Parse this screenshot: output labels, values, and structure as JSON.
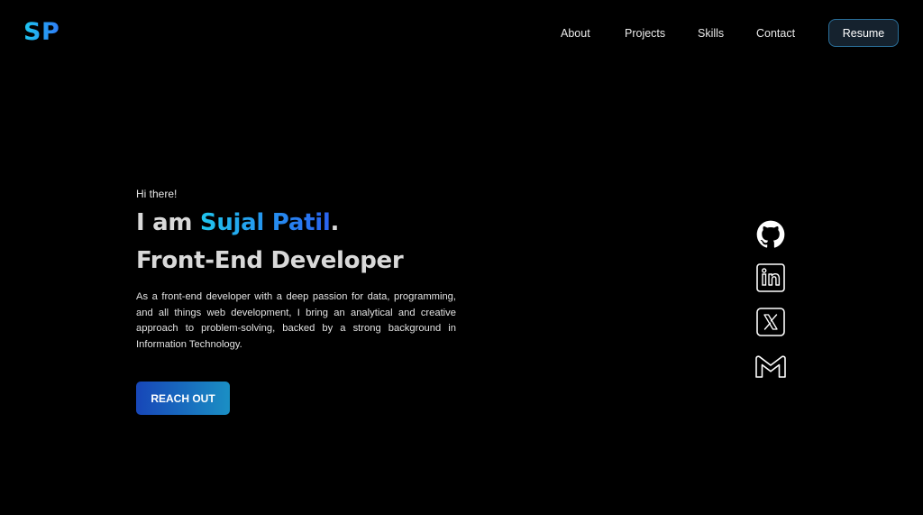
{
  "header": {
    "logo": "SP",
    "nav": [
      "About",
      "Projects",
      "Skills",
      "Contact"
    ],
    "resume_label": "Resume"
  },
  "hero": {
    "greeting": "Hi there!",
    "headline_prefix": "I am ",
    "name": "Sujal Patil",
    "headline_suffix": ".",
    "role": "Front-End Developer",
    "bio": "As a front-end developer with a deep passion for data, programming, and all things web development, I bring an analytical and creative approach to problem-solving, backed by a strong background in Information Technology.",
    "cta_label": "REACH OUT"
  },
  "social": {
    "icons": [
      "github-icon",
      "linkedin-icon",
      "x-twitter-icon",
      "gmail-icon"
    ]
  },
  "colors": {
    "background": "#000000",
    "accent_start": "#20c6ee",
    "accent_end": "#2a63f0",
    "text": "#d9d9d9"
  }
}
